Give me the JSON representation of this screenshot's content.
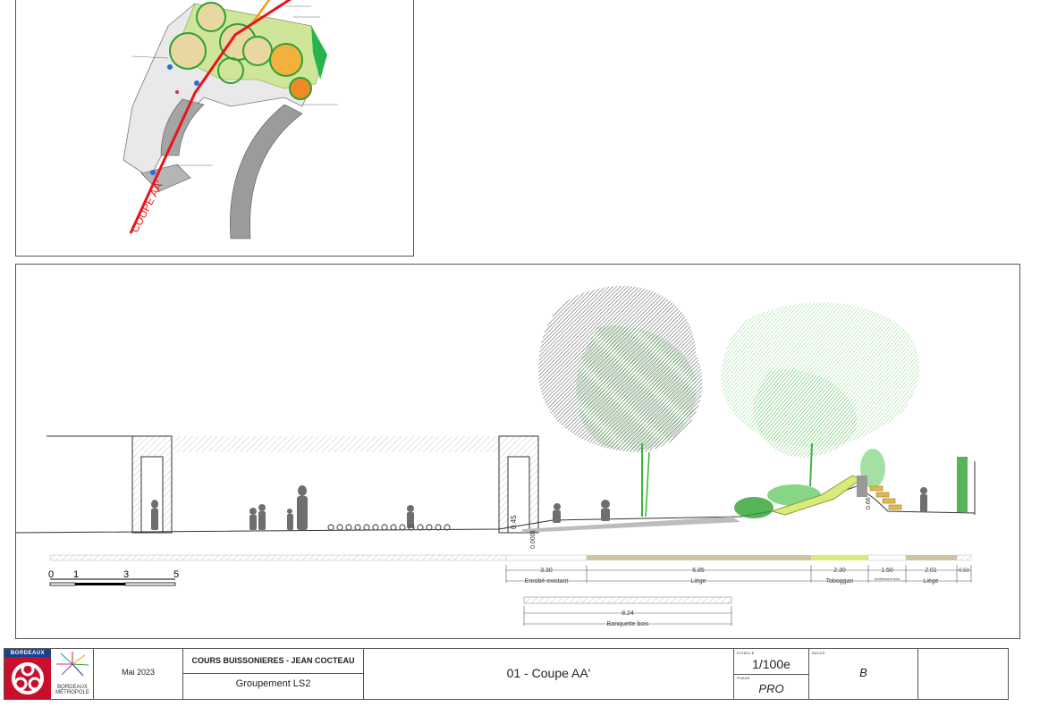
{
  "plan": {
    "section_line_label": "COUPE AA'"
  },
  "section": {
    "level_labels": {
      "left": "0.45",
      "bottom": "0.0001",
      "right": "0.66"
    },
    "scale_bar": {
      "ticks": [
        "0",
        "1",
        "3",
        "5"
      ]
    },
    "dimensions": [
      {
        "value": "3.30",
        "label": "Enrobé existant"
      },
      {
        "value": "6.85",
        "label": "Liège"
      },
      {
        "value": "2.30",
        "label": "Toboggan"
      },
      {
        "value": "1.50",
        "label": "revêtement bois"
      },
      {
        "value": "2.01",
        "label": "Liège"
      },
      {
        "value": "0.50",
        "label": ""
      }
    ],
    "bench": {
      "value": "8.24",
      "label": "Banquette bois"
    }
  },
  "title_block": {
    "logo_top": "BORDEAUX",
    "logo_line1": "BORDEAUX",
    "logo_line2": "MÉTROPOLE",
    "date": "Mai 2023",
    "project": "COURS BUISSONIERES - JEAN COCTEAU",
    "group": "Groupement LS2",
    "drawing": "01 - Coupe AA'",
    "scale_caption": "ECHELLE",
    "scale": "1/100e",
    "phase_caption": "PHASE",
    "phase": "PRO",
    "index_caption": "INDICE",
    "index": "B"
  },
  "colors": {
    "section_line": "#e8141c",
    "tree_green": "#2ea12e",
    "light_green": "#5ec85e",
    "liege": "#cfc3a0",
    "toboggan": "#d9ec7a",
    "logo_red": "#c8102e",
    "logo_blue": "#1a3f8f"
  }
}
